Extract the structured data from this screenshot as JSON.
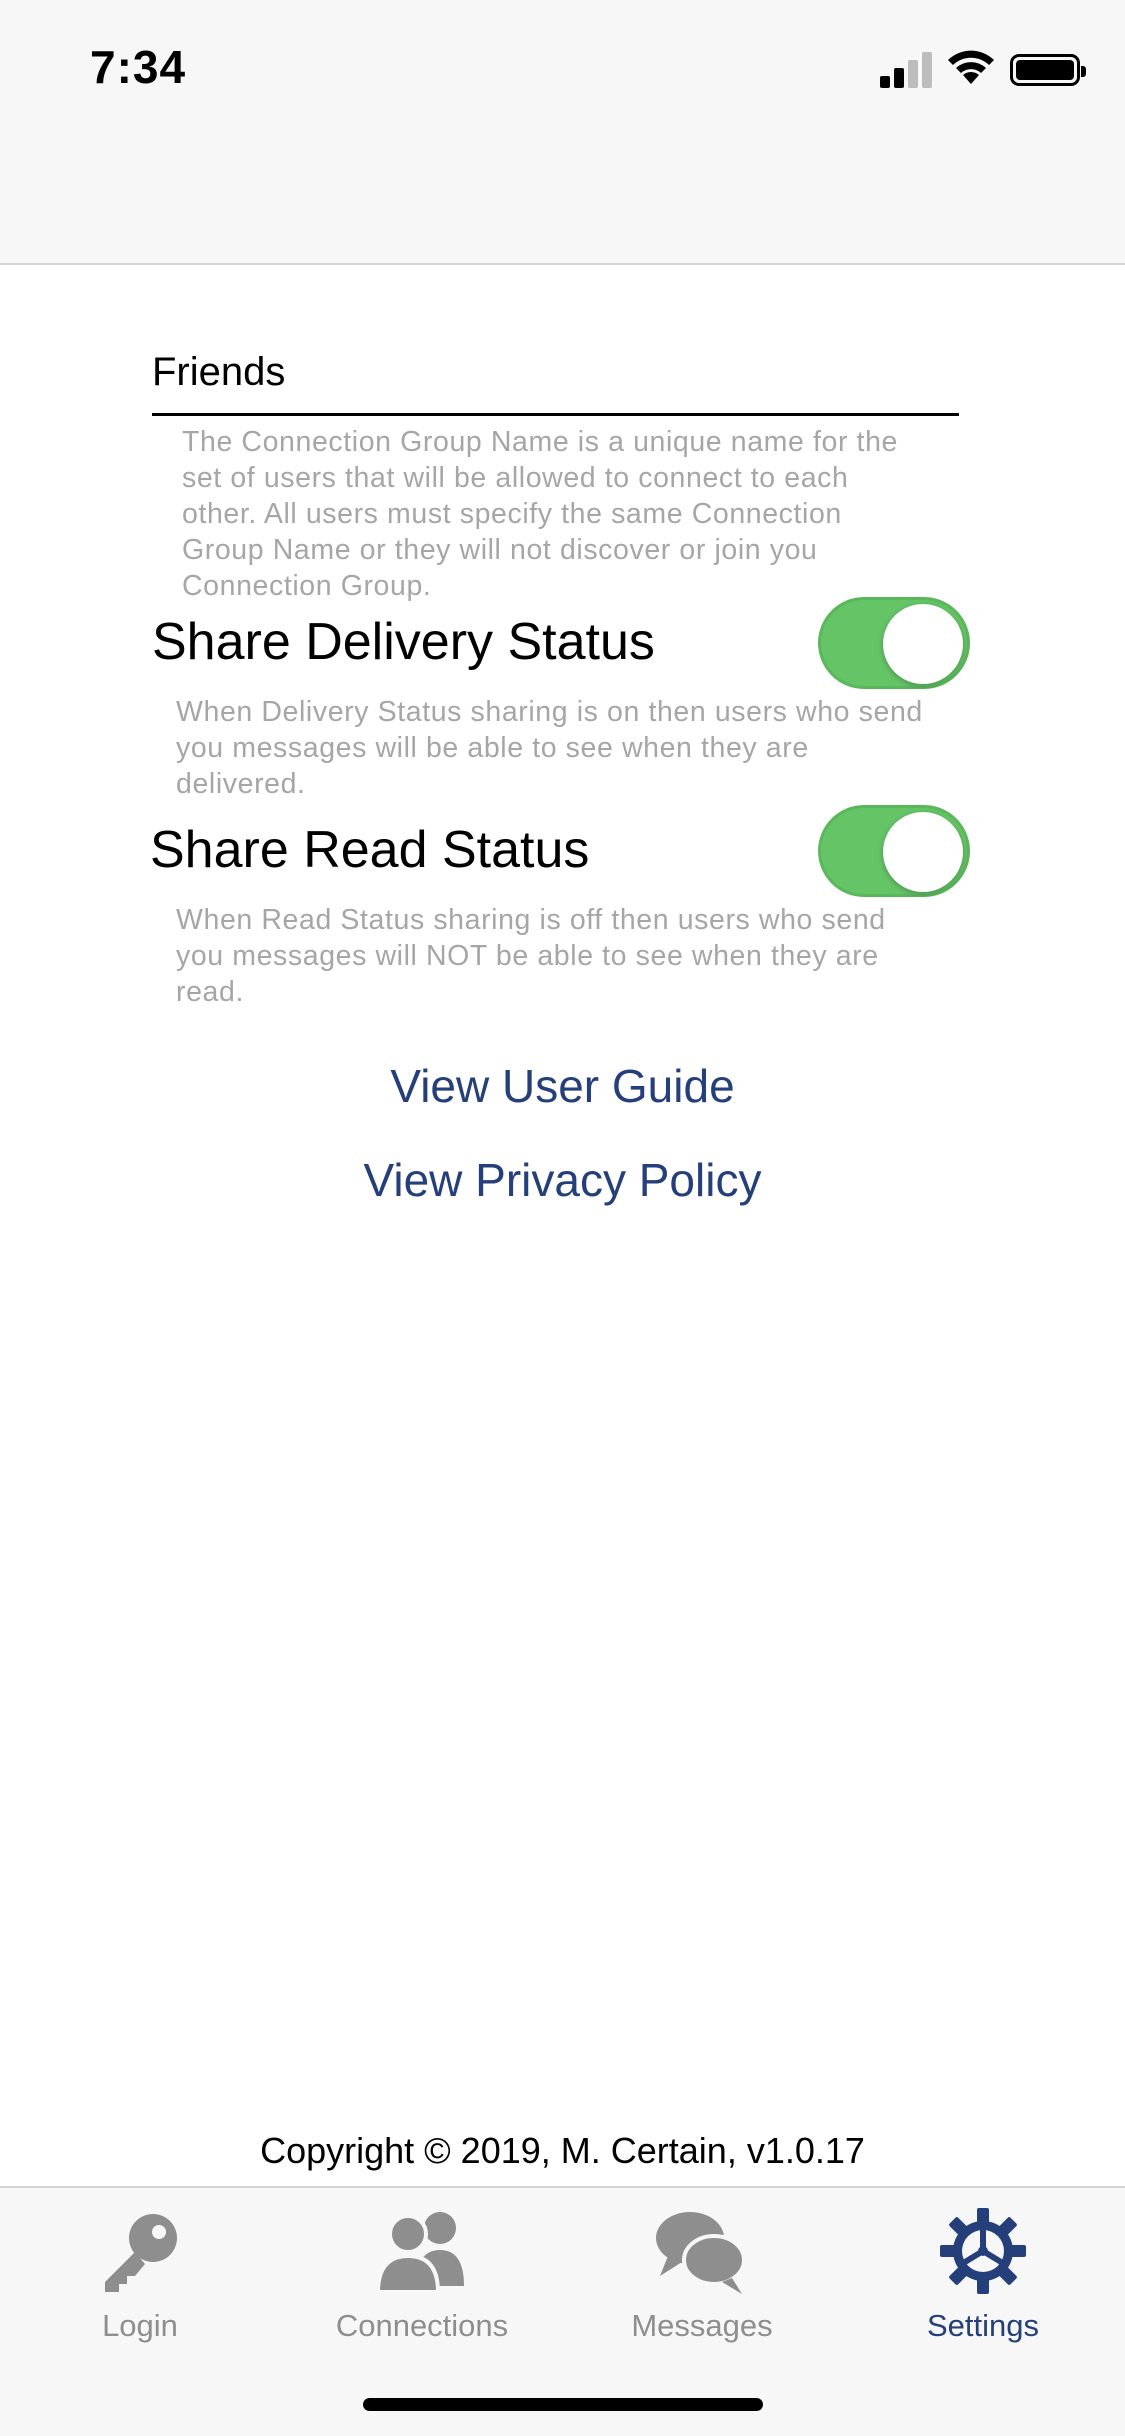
{
  "status_bar": {
    "time": "7:34",
    "icons": [
      "cellular-signal-icon",
      "wifi-icon",
      "battery-icon"
    ]
  },
  "settings": {
    "group_name_value": "Friends",
    "group_name_help": "The Connection Group Name is a unique name for the set of users that will be allowed to connect to each other. All users must specify the same Connection Group Name or they will not discover or join you Connection Group.",
    "share_delivery_label": "Share Delivery Status",
    "share_delivery_on": true,
    "share_delivery_help": "When Delivery Status sharing is on then users who send you messages will be able to see when they are delivered.",
    "share_read_label": "Share Read Status",
    "share_read_on": true,
    "share_read_help": "When Read Status sharing is off then users who send you messages will NOT be able to see when they are read."
  },
  "links": {
    "user_guide": "View User Guide",
    "privacy_policy": "View Privacy Policy"
  },
  "footer": {
    "copyright": "Copyright © 2019, M. Certain, v1.0.17"
  },
  "tabbar": {
    "active": "Settings",
    "tabs": [
      {
        "label": "Login",
        "icon": "key-icon"
      },
      {
        "label": "Connections",
        "icon": "people-icon"
      },
      {
        "label": "Messages",
        "icon": "chat-bubbles-icon"
      },
      {
        "label": "Settings",
        "icon": "gear-icon"
      }
    ]
  },
  "colors": {
    "accent": "#243f7a",
    "toggle_on": "#65c466",
    "help_text": "#a6a6a6",
    "tab_inactive": "#8e8e8e"
  }
}
